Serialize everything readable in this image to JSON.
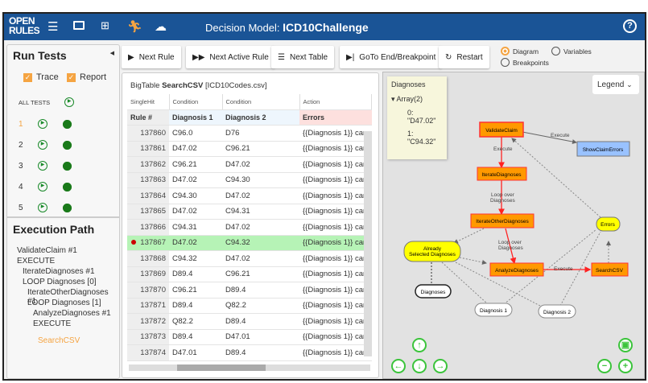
{
  "header": {
    "logo_line1": "OPEN",
    "logo_line2": "RULES",
    "title_prefix": "Decision Model:",
    "model_name": "ICD10Challenge",
    "help": "?"
  },
  "left": {
    "run_tests": "Run Tests",
    "trace": "Trace",
    "report": "Report",
    "all_tests": "ALL TESTS",
    "tests": [
      "1",
      "2",
      "3",
      "4",
      "5"
    ],
    "execution_path_title": "Execution Path",
    "path": [
      {
        "text": "ValidateClaim #1",
        "indent": 0
      },
      {
        "text": "EXECUTE",
        "indent": 0
      },
      {
        "text": "IterateDiagnoses #1",
        "indent": 1
      },
      {
        "text": "LOOP Diagnoses [0]",
        "indent": 1
      },
      {
        "text": "IterateOtherDiagnoses #1",
        "indent": 2
      },
      {
        "text": "LOOP Diagnoses [1]",
        "indent": 2
      },
      {
        "text": "AnalyzeDiagnoses #1",
        "indent": 3
      },
      {
        "text": "EXECUTE",
        "indent": 3
      }
    ],
    "current": "SearchCSV"
  },
  "toolbar": {
    "next_rule": "Next Rule",
    "next_active_rule": "Next Active Rule",
    "next_table": "Next Table",
    "goto_end": "GoTo End/Breakpoint",
    "restart": "Restart",
    "view_options": {
      "diagram": "Diagram",
      "variables": "Variables",
      "breakpoints": "Breakpoints",
      "selected": "Diagram"
    }
  },
  "table": {
    "type": "BigTable",
    "name": "SearchCSV",
    "file": "[ICD10Codes.csv]",
    "header1": [
      "SingleHit",
      "Condition",
      "Condition",
      "Action"
    ],
    "header2": [
      "Rule #",
      "Diagnosis 1",
      "Diagnosis 2",
      "Errors"
    ],
    "rows": [
      [
        "137860",
        "C96.0",
        "D76",
        "{{Diagnosis 1}} cann"
      ],
      [
        "137861",
        "D47.02",
        "C96.21",
        "{{Diagnosis 1}} cann"
      ],
      [
        "137862",
        "C96.21",
        "D47.02",
        "{{Diagnosis 1}} cann"
      ],
      [
        "137863",
        "D47.02",
        "C94.30",
        "{{Diagnosis 1}} cann"
      ],
      [
        "137864",
        "C94.30",
        "D47.02",
        "{{Diagnosis 1}} cann"
      ],
      [
        "137865",
        "D47.02",
        "C94.31",
        "{{Diagnosis 1}} cann"
      ],
      [
        "137866",
        "C94.31",
        "D47.02",
        "{{Diagnosis 1}} cann"
      ],
      [
        "137867",
        "D47.02",
        "C94.32",
        "{{Diagnosis 1}} cann"
      ],
      [
        "137868",
        "C94.32",
        "D47.02",
        "{{Diagnosis 1}} cann"
      ],
      [
        "137869",
        "D89.4",
        "C96.21",
        "{{Diagnosis 1}} cann"
      ],
      [
        "137870",
        "C96.21",
        "D89.4",
        "{{Diagnosis 1}} cann"
      ],
      [
        "137871",
        "D89.4",
        "Q82.2",
        "{{Diagnosis 1}} cann"
      ],
      [
        "137872",
        "Q82.2",
        "D89.4",
        "{{Diagnosis 1}} cann"
      ],
      [
        "137873",
        "D89.4",
        "D47.01",
        "{{Diagnosis 1}} cann"
      ],
      [
        "137874",
        "D47.01",
        "D89.4",
        "{{Diagnosis 1}} cann"
      ]
    ],
    "highlighted_rule": "137867"
  },
  "diagram": {
    "var_title": "Diagnoses",
    "array": "Array(2)",
    "items": [
      "0: \"D47.02\"",
      "1: \"C94.32\""
    ],
    "legend": "Legend",
    "nodes": {
      "validate": "ValidateClaim",
      "show": "ShowClaimErrors",
      "iterate": "IterateDiagnoses",
      "iterate_other": "IterateOtherDiagnoses",
      "errors": "Errors",
      "already1": "Already",
      "already2": "Selected Diagnoses",
      "analyze": "AnalyzeDiagnoses",
      "search": "SearchCSV",
      "diagnoses": "Diagnoses",
      "diag1": "Diagnosis 1",
      "diag2": "Diagnosis 2"
    },
    "edges": {
      "execute": "Execute",
      "loop1": "Loop over",
      "loop2": "Diagnoses"
    }
  }
}
